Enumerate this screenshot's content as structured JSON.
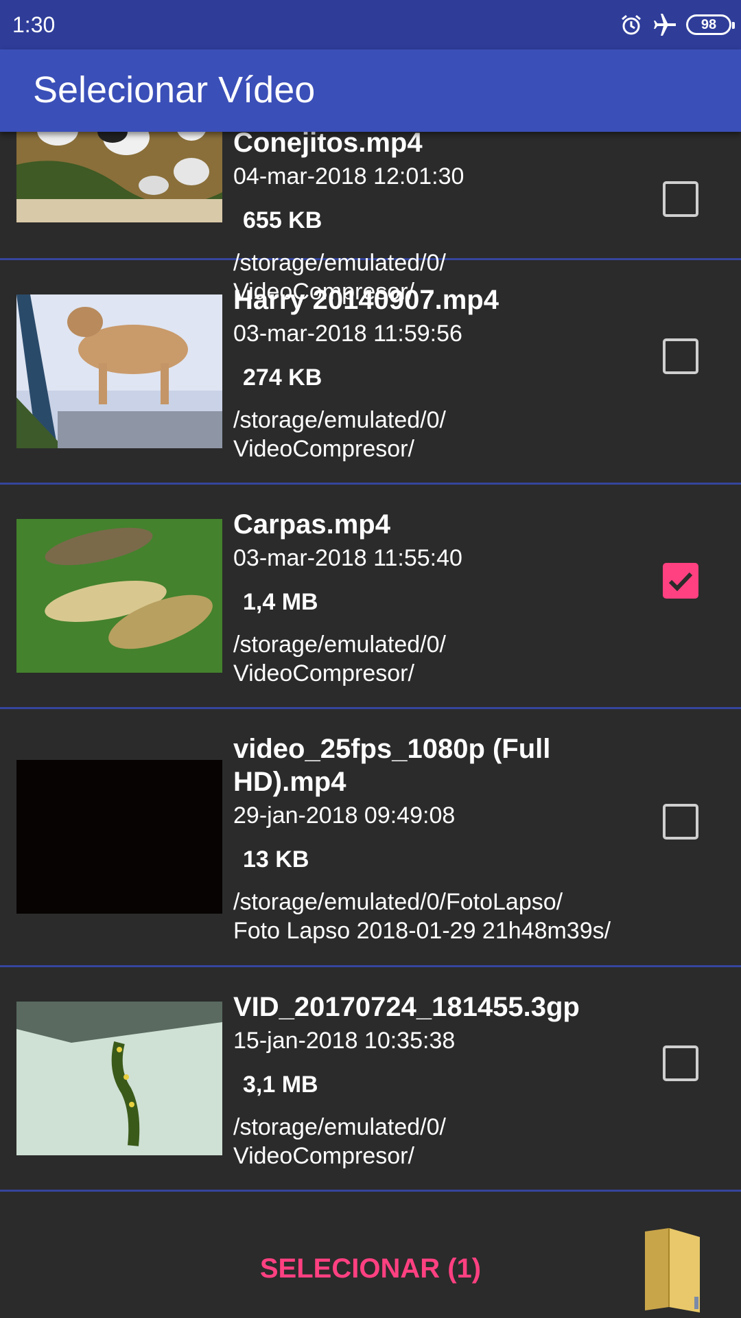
{
  "status_bar": {
    "time": "1:30",
    "icons": [
      "alarm-icon",
      "airplane-mode-icon",
      "battery-icon"
    ],
    "battery_level": "98"
  },
  "app_bar": {
    "title": "Selecionar Vídeo"
  },
  "videos": [
    {
      "name": "Conejitos.mp4",
      "date": "04-mar-2018 12:01:30",
      "size": "655 KB",
      "path_line1": "/storage/emulated/0/",
      "path_line2": "VideoCompresor/",
      "checked": false
    },
    {
      "name": "Harry 20140907.mp4",
      "date": "03-mar-2018 11:59:56",
      "size": "274 KB",
      "path_line1": "/storage/emulated/0/",
      "path_line2": "VideoCompresor/",
      "checked": false
    },
    {
      "name": "Carpas.mp4",
      "date": "03-mar-2018 11:55:40",
      "size": "1,4 MB",
      "path_line1": "/storage/emulated/0/",
      "path_line2": "VideoCompresor/",
      "checked": true
    },
    {
      "name": "video_25fps_1080p (Full HD).mp4",
      "date": "29-jan-2018 09:49:08",
      "size": "13 KB",
      "path_line1": "/storage/emulated/0/FotoLapso/",
      "path_line2": "Foto Lapso 2018-01-29 21h48m39s/",
      "checked": false
    },
    {
      "name": "VID_20170724_181455.3gp",
      "date": "15-jan-2018 10:35:38",
      "size": "3,1 MB",
      "path_line1": "/storage/emulated/0/",
      "path_line2": "VideoCompresor/",
      "checked": false
    }
  ],
  "bottom_bar": {
    "select_label": "SELECIONAR (1)",
    "folder_icon": "folder-icon"
  },
  "colors": {
    "status_bar": "#2f3d99",
    "app_bar": "#3b4fb8",
    "background": "#2b2b2b",
    "accent": "#ff4081",
    "divider": "#35459e"
  }
}
